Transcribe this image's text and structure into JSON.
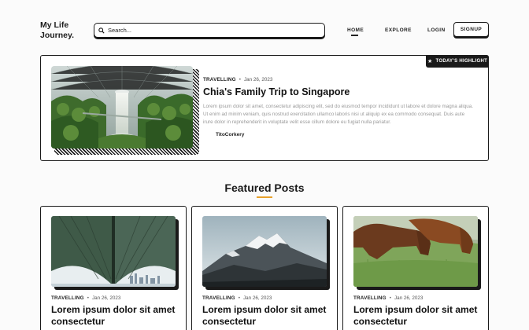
{
  "header": {
    "logo_line1": "My Life",
    "logo_line2": "Journey.",
    "search_placeholder": "Search...",
    "nav": {
      "home": "HOME",
      "explore": "EXPLORE",
      "login": "LOGIN",
      "signup": "SIGNUP"
    }
  },
  "highlight": {
    "badge": "TODAY'S HIGHLIGHT",
    "category": "TRAVELLING",
    "date": "Jan 26, 2023",
    "title": "Chia's Family Trip to Singapore",
    "excerpt": "Lorem ipsum dolor sit amet, consectetur adipiscing elit, sed do eiusmod tempor incididunt ut labore et dolore magna aliqua. Ut enim ad minim veniam, quis nostrud exercitation ullamco laboris nisi ut aliquip ex ea commodo consequat. Duis aute irure dolor in reprehenderit in voluptate velit esse cillum dolore eu fugiat nulla pariatur.",
    "author": "TitoCorkery"
  },
  "featured": {
    "heading": "Featured Posts",
    "accent": "#e8a02a",
    "posts": [
      {
        "category": "TRAVELLING",
        "date": "Jan 26, 2023",
        "title": "Lorem ipsum dolor sit amet consectetur",
        "image": "bridge-underside"
      },
      {
        "category": "TRAVELLING",
        "date": "Jan 26, 2023",
        "title": "Lorem ipsum dolor sit amet consectetur",
        "image": "snowy-mountain"
      },
      {
        "category": "TRAVELLING",
        "date": "Jan 26, 2023",
        "title": "Lorem ipsum dolor sit amet consectetur",
        "image": "dogs-on-grass"
      }
    ]
  }
}
